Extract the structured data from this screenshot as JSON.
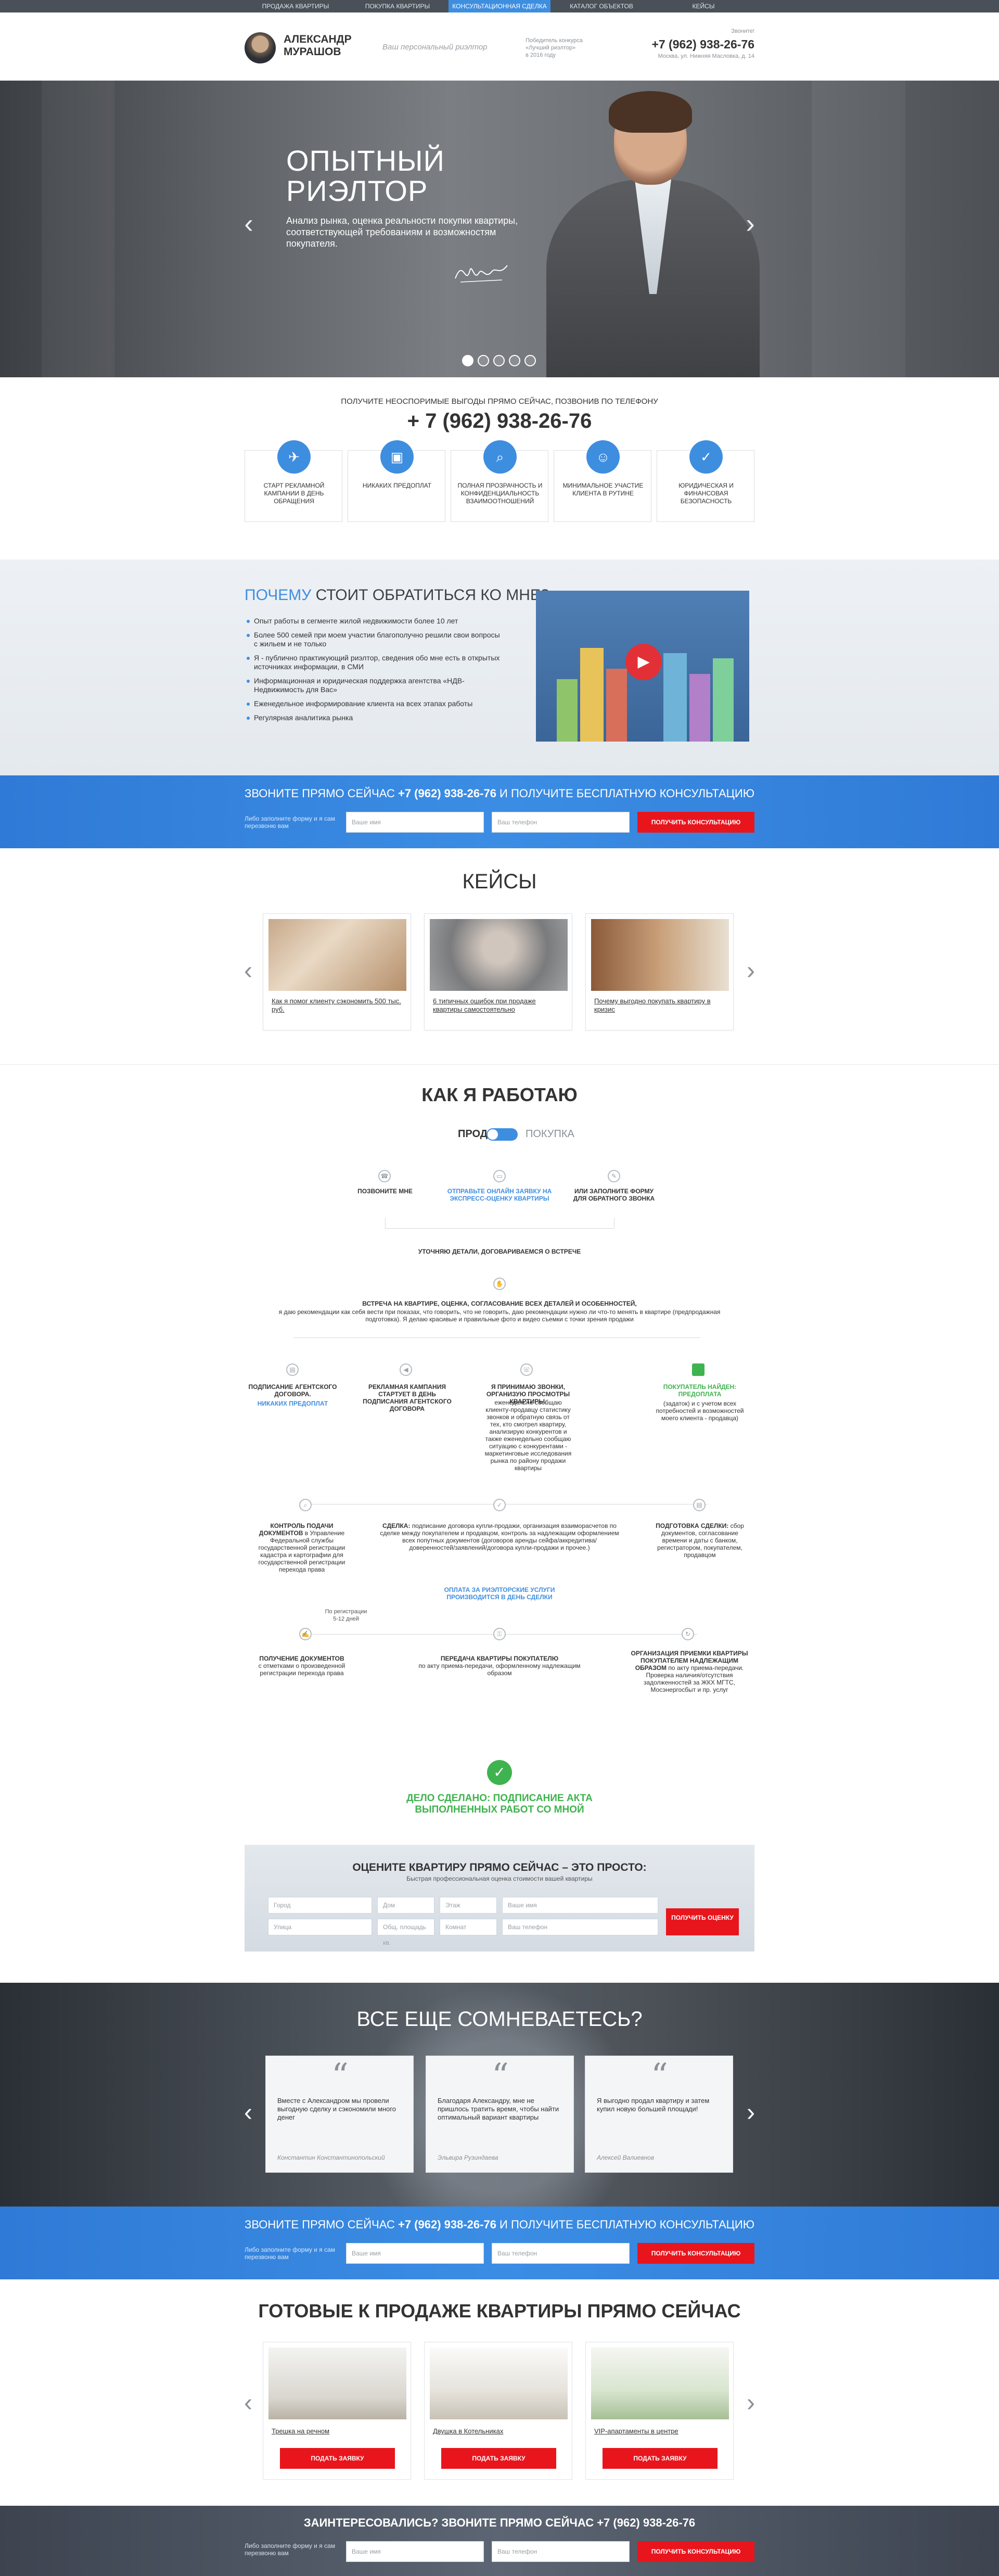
{
  "topnav": {
    "items": [
      {
        "label": "Продажа квартиры"
      },
      {
        "label": "Покупка квартиры"
      },
      {
        "label": "Консультационная сделка",
        "active": true
      },
      {
        "label": "Каталог объектов"
      },
      {
        "label": "Кейсы"
      }
    ]
  },
  "header": {
    "name": "Александр\nМурашов",
    "tagline": "Ваш персональный риэлтор",
    "award": "Победитель конкурса\n«Лучший риэлтор»\nв 2016 году",
    "phone_label": "Звоните!",
    "phone": "+7 (962) 938-26-76",
    "address": "Москва, ул. Нижняя Масловка, д. 14"
  },
  "hero": {
    "title": "Опытный риэлтор",
    "subtitle": "Анализ рынка, оценка реальности покупки квартиры, соответствующей требованиям и возможностям покупателя.",
    "prev_glyph": "‹",
    "next_glyph": "›",
    "slides": 5,
    "active_slide": 1
  },
  "call": {
    "label": "Получите неоспоримые выгоды прямо сейчас, позвонив по телефону",
    "phone": "+ 7 (962) 938-26-76",
    "benefits": [
      {
        "icon": "rocket-icon",
        "glyph": "✈",
        "text": "Старт рекламной кампании в день обращения"
      },
      {
        "icon": "wallet-icon",
        "glyph": "▣",
        "text": "Никаких предоплат"
      },
      {
        "icon": "magnifier-icon",
        "glyph": "⌕",
        "text": "Полная прозрачность и конфиденциальность взаимоотношений"
      },
      {
        "icon": "smile-icon",
        "glyph": "☺",
        "text": "Минимальное участие клиента в рутине"
      },
      {
        "icon": "shield-check-icon",
        "glyph": "✓",
        "text": "Юридическая и финансовая безопасность"
      }
    ]
  },
  "why": {
    "title_accent": "Почему",
    "title_rest": " стоит обратиться ко мне?",
    "items": [
      "Опыт работы в сегменте жилой недвижимости более 10 лет",
      "Более 500 семей при моем участии благополучно решили свои вопросы с жильем и не только",
      "Я - публично практикующий риэлтор, сведения обо мне есть в открытых источниках информации, в СМИ",
      "Информационная и юридическая поддержка агентства «НДВ-Недвижимость для Вас»",
      "Еженедельное информирование клиента на всех этапах работы",
      "Регулярная аналитика рынка"
    ],
    "play_glyph": "▶"
  },
  "cta": {
    "title_a": "Звоните прямо сейчас ",
    "title_phone": "+7 (962) 938-26-76",
    "title_b": " и получите бесплатную консультацию",
    "note": "Либо заполните форму и я сам перезвоню вам",
    "name_placeholder": "Ваше имя",
    "phone_placeholder": "Ваш телефон",
    "button": "Получить консультацию"
  },
  "cases": {
    "title": "Кейсы",
    "prev_glyph": "‹",
    "next_glyph": "›",
    "items": [
      {
        "caption": "Как я помог клиенту сэкономить 500 тыс. руб."
      },
      {
        "caption": "6 типичных ошибок при продаже квартиры самостоятельно"
      },
      {
        "caption": "Почему выгодно покупать квартиру в кризис"
      }
    ]
  },
  "process": {
    "title": "Как я работаю",
    "toggle_left": "Продажа",
    "toggle_right": "Покупка",
    "step1": "Позвоните мне",
    "step2": "Отправьте онлайн заявку на экспресс-оценку квартиры",
    "step3": "Или заполните форму для обратного звонка",
    "meet": "Уточняю детали, договариваемся о встрече",
    "meeting_title": "Встреча на квартире, оценка, согласование всех деталей и особенностей,",
    "meeting_text": "я даю рекомендации как себя вести при показах, что говорить, что не говорить, даю рекомендации нужно ли что-то менять в квартире (предпродажная подготовка). Я делаю красивые и правильные фото и видео съемки с точки зрения продажи",
    "sign_title": "Подписание агентского договора.",
    "sign_note": "Никаких предоплат",
    "ads_title": "Рекламная кампания стартует в день подписания агентского договора",
    "calls_title": "Я принимаю звонки, организую просмотры квартиры,",
    "calls_text": "еженедельно сообщаю клиенту-продавцу статистику звонков и обратную связь от тех, кто смотрел квартиру, анализирую конкурентов и также еженедельно сообщаю ситуацию с конкурентами - маркетинговые исследования рынка по району продажи квартиры",
    "buyer_title": "Покупатель найден: предоплата",
    "buyer_text": "(задаток) и с учетом всех потребностей и возможностей моего клиента - продавца)",
    "control_title": "Контроль подачи документов",
    "control_text": "в Управление Федеральной службы государственной регистрации кадастра и картографии для государственной регистрации перехода права",
    "reg_term": "По регистрации 5-12 дней",
    "deal_title": "Сделка:",
    "deal_text": "подписание договора купли-продажи, организация взаиморасчетов по сделке между покупателем и продавцом, контроль за надлежащим оформлением всех попутных документов (договоров аренды сейфа/аккредитива/доверенностей/заявлений/договора купли-продажи и прочее.)",
    "deal_note": "Оплата за риэлторские услуги производится в день сделки",
    "prep_title": "Подготовка сделки:",
    "prep_text": "сбор документов, согласование времени и даты с банком, регистратором, покупателем, продавцом",
    "docs_title": "Получение документов",
    "docs_text": "с отметками о произведенной регистрации перехода права",
    "transfer_title": "Передача квартиры покупателю",
    "transfer_text": "по акту приема-передачи, оформленному надлежащим образом",
    "org_title": "Организация приемки квартиры покупателем надлежащим образом",
    "org_text": "по акту приема-передачи. Проверка наличия/отсутствия задолженностей за ЖКХ МГТС, Мосэнергосбыт и пр. услуг",
    "done": "Дело сделано: подписание акта выполненных работ со мной"
  },
  "estimate": {
    "title": "Оцените квартиру прямо сейчас – это просто:",
    "subtitle": "Быстрая профессиональная оценка стоимости вашей квартиры",
    "fields": [
      "Город",
      "Дом",
      "Этаж",
      "Ваше имя",
      "Улица",
      "Общ. площадь кв.",
      "Комнат",
      "Ваш телефон"
    ],
    "button": "Получить оценку"
  },
  "reviews": {
    "title": "Все еще сомневаетесь?",
    "items": [
      {
        "text": "Вместе с Александром мы провели выгодную сделку и сэкономили много денег",
        "author": "Константин Константинопольский"
      },
      {
        "text": "Благодаря Александру, мне не пришлось тратить время, чтобы найти оптимальный вариант квартиры",
        "author": "Эльвира Рузиндаева"
      },
      {
        "text": "Я выгодно продал квартиру и затем купил новую большей площади!",
        "author": "Алексей Валиевнов"
      }
    ]
  },
  "flats": {
    "title": "Готовые к продаже квартиры прямо сейчас",
    "button": "Подать заявку",
    "items": [
      {
        "caption": "Трешка на речном"
      },
      {
        "caption": "Двушка в Котельниках"
      },
      {
        "caption": "VIP-апартаменты в центре"
      }
    ]
  },
  "final": {
    "title_a": "Заинтересовались? Звоните прямо сейчас ",
    "title_phone": "+7 (962) 938-26-76"
  },
  "colors": {
    "accent": "#3e8ee0",
    "cta_red": "#e8151d",
    "done_green": "#3fb34f"
  }
}
